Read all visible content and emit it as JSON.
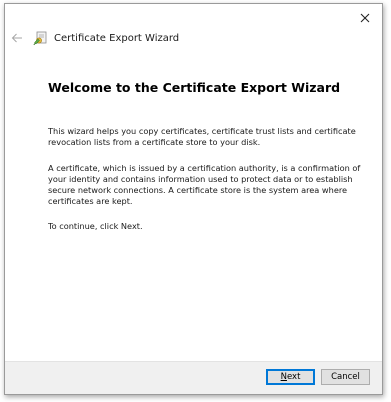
{
  "window": {
    "title": "Certificate Export Wizard",
    "icons": {
      "close": "close-icon",
      "back": "back-arrow-icon",
      "app": "certificate-wizard-icon"
    }
  },
  "content": {
    "heading": "Welcome to the Certificate Export Wizard",
    "paragraph1": "This wizard helps you copy certificates, certificate trust lists and certificate revocation lists from a certificate store to your disk.",
    "paragraph2": "A certificate, which is issued by a certification authority, is a confirmation of your identity and contains information used to protect data or to establish secure network connections. A certificate store is the system area where certificates are kept.",
    "paragraph3": "To continue, click Next."
  },
  "footer": {
    "next_mnemonic": "N",
    "next_rest": "ext",
    "cancel_label": "Cancel"
  },
  "colors": {
    "accent": "#0078d7",
    "footer_bg": "#f0f0f0",
    "button_bg": "#e1e1e1"
  }
}
